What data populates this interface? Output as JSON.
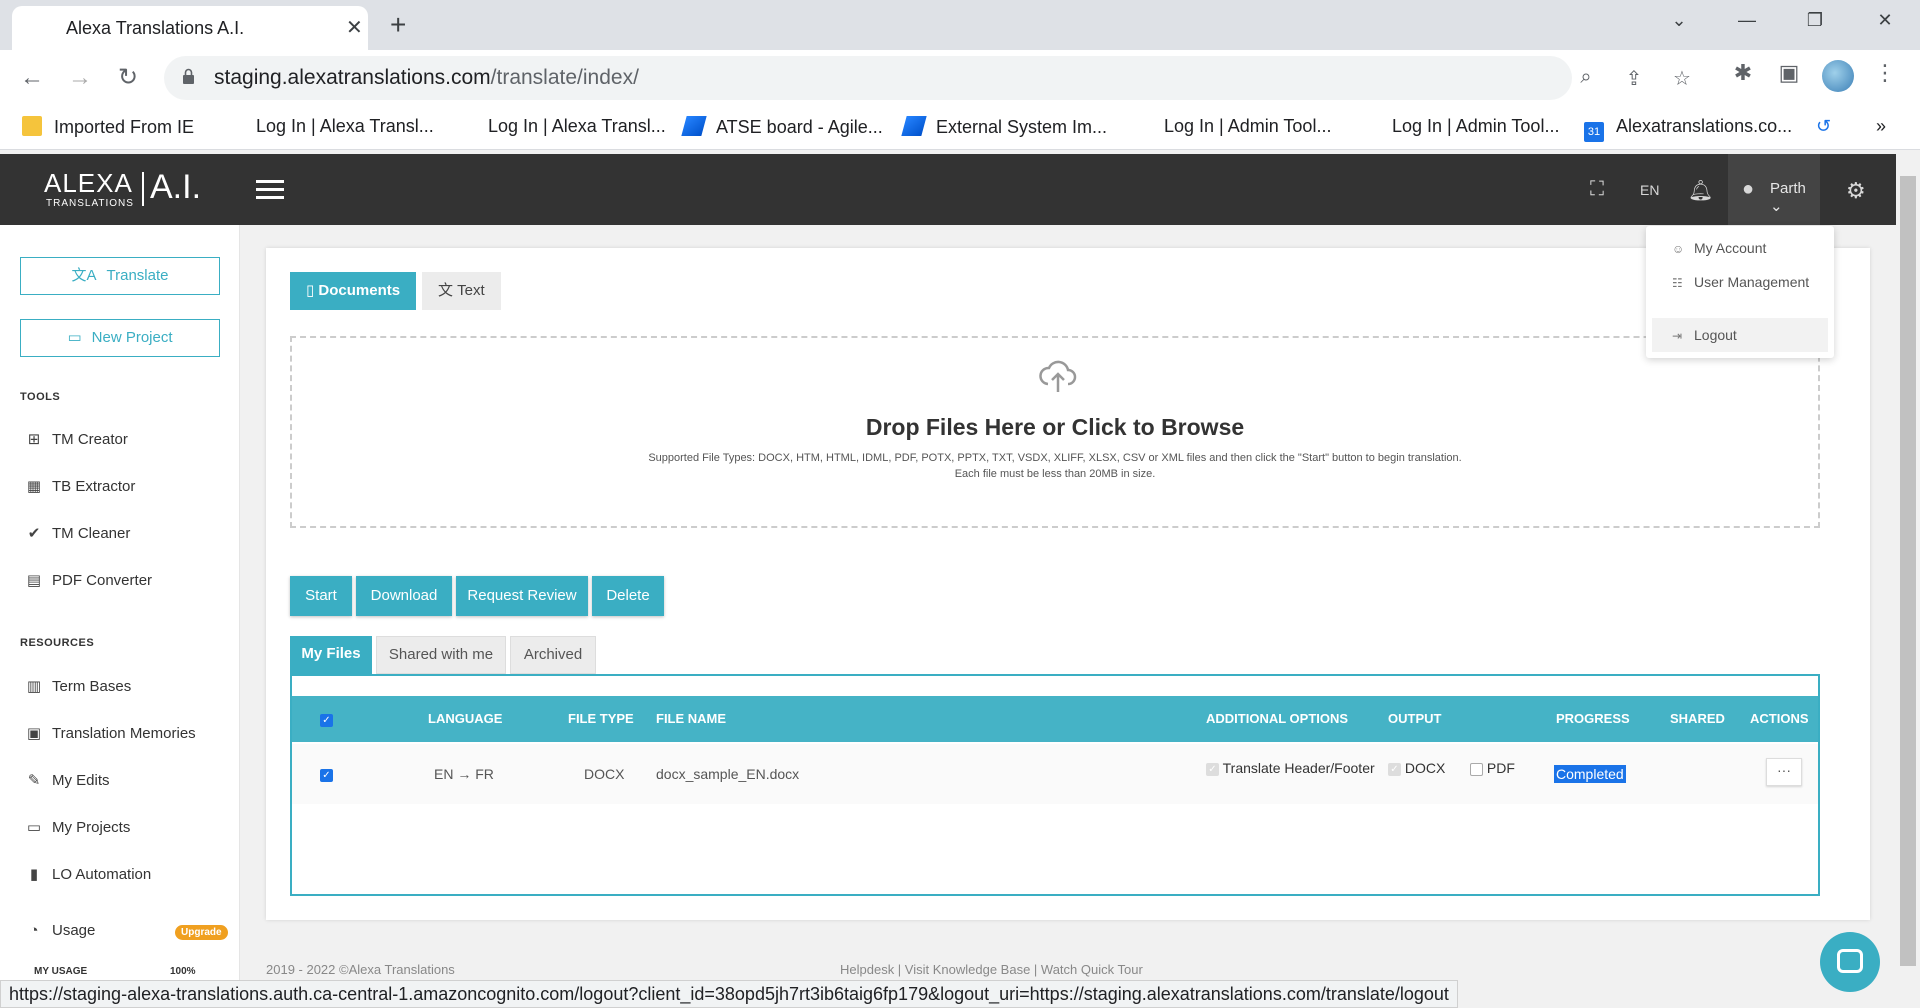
{
  "browser": {
    "tab_title": "Alexa Translations A.I.",
    "tab_close": "✕",
    "new_tab": "+",
    "url_host": "staging.alexatranslations.com",
    "url_path": "/translate/index/"
  },
  "bookmarks": [
    {
      "label": "Imported From IE"
    },
    {
      "label": "Log In | Alexa Transl..."
    },
    {
      "label": "Log In | Alexa Transl..."
    },
    {
      "label": "ATSE board - Agile..."
    },
    {
      "label": "External System Im..."
    },
    {
      "label": "Log In | Admin Tool..."
    },
    {
      "label": "Log In | Admin Tool..."
    },
    {
      "label": "Alexatranslations.co..."
    }
  ],
  "header": {
    "logo_main": "ALEXA",
    "logo_sub": "TRANSLATIONS",
    "logo_ai": "A.I.",
    "lang": "EN",
    "user": "Parth"
  },
  "sidebar": {
    "translate_btn": "Translate",
    "new_project_btn": "New Project",
    "tools_heading": "TOOLS",
    "tools": [
      "TM Creator",
      "TB Extractor",
      "TM Cleaner",
      "PDF Converter"
    ],
    "resources_heading": "RESOURCES",
    "resources": [
      "Term Bases",
      "Translation Memories",
      "My Edits",
      "My Projects",
      "LO Automation"
    ],
    "usage_label": "Usage",
    "upgrade_badge": "Upgrade",
    "my_usage": "MY USAGE",
    "usage_percent": "100%"
  },
  "main": {
    "mode_documents": "Documents",
    "mode_text": "Text",
    "drop_title": "Drop Files Here or Click to Browse",
    "drop_sub1": "Supported File Types: DOCX, HTM, HTML, IDML, PDF, POTX, PPTX, TXT, VSDX, XLIFF, XLSX, CSV or XML files and then click the \"Start\" button to begin translation.",
    "drop_sub2": "Each file must be less than 20MB in size.",
    "actions": [
      "Start",
      "Download",
      "Request Review",
      "Delete"
    ],
    "file_tabs": [
      "My Files",
      "Shared with me",
      "Archived"
    ],
    "columns": [
      "LANGUAGE",
      "FILE TYPE",
      "FILE NAME",
      "ADDITIONAL OPTIONS",
      "OUTPUT",
      "PROGRESS",
      "SHARED",
      "ACTIONS"
    ],
    "rows": [
      {
        "language": "EN → FR",
        "file_type": "DOCX",
        "file_name": "docx_sample_EN.docx",
        "option": "Translate Header/Footer",
        "output_docx": "DOCX",
        "output_pdf": "PDF",
        "progress": "Completed",
        "actions": "···"
      }
    ]
  },
  "dropdown": {
    "items": [
      "My Account",
      "User Management",
      "Logout"
    ]
  },
  "footer": {
    "copyright": "2019 - 2022 ©Alexa Translations",
    "links": "Helpdesk   |   Visit Knowledge Base   |   Watch Quick Tour"
  },
  "statusbar": "https://staging-alexa-translations.auth.ca-central-1.amazoncognito.com/logout?client_id=38opd5jh7rt3ib6taig6fp179&logout_uri=https://staging.alexatranslations.com/translate/logout",
  "colors": {
    "accent": "#3aaec3",
    "header_bg": "#333333",
    "checkbox": "#1a73e8"
  }
}
